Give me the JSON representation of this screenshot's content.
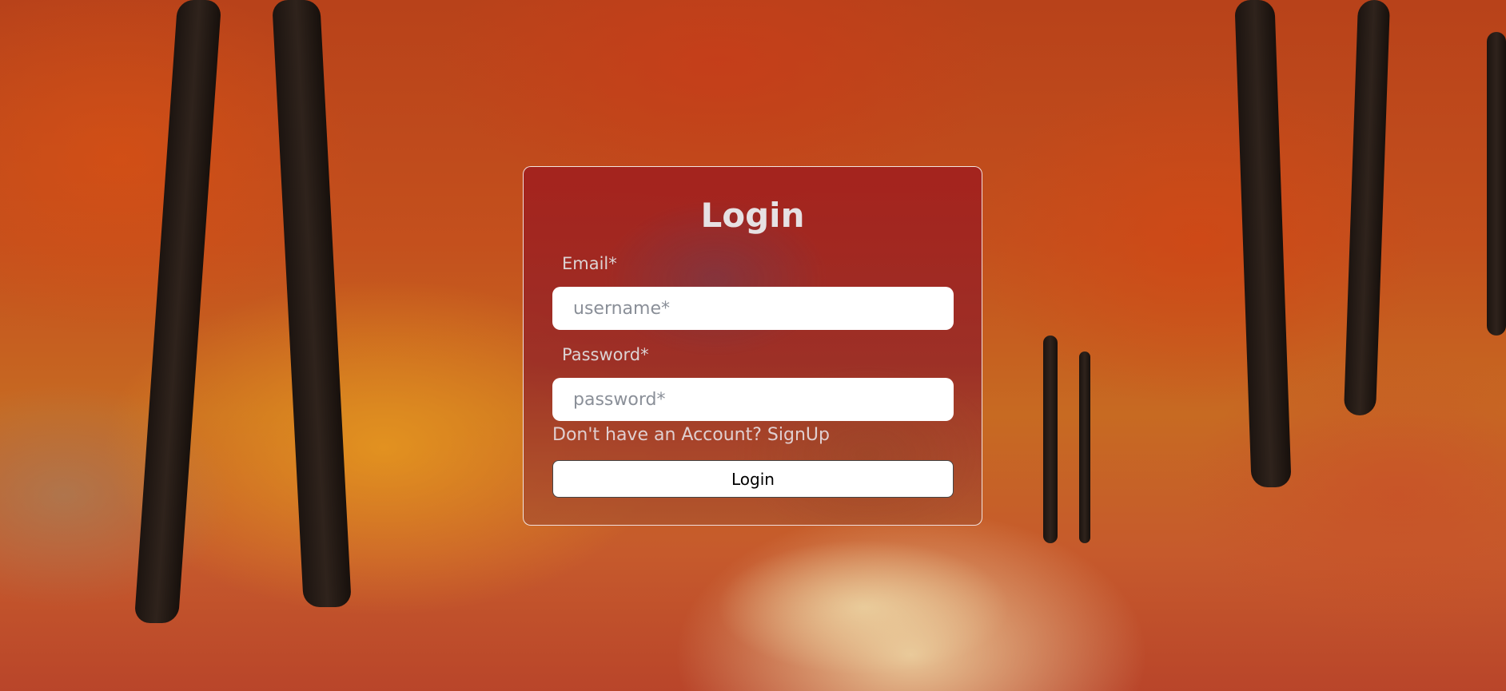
{
  "page": {
    "title": "Login"
  },
  "form": {
    "email_label": "Email*",
    "email_placeholder": "username*",
    "password_label": "Password*",
    "password_placeholder": "password*",
    "signup_prompt": "Don't have an Account? ",
    "signup_link": "SignUp",
    "submit_label": "Login"
  },
  "colors": {
    "card_tint": "#a01e1e",
    "text_light": "#e6e1e3",
    "button_bg": "#ffffff"
  }
}
